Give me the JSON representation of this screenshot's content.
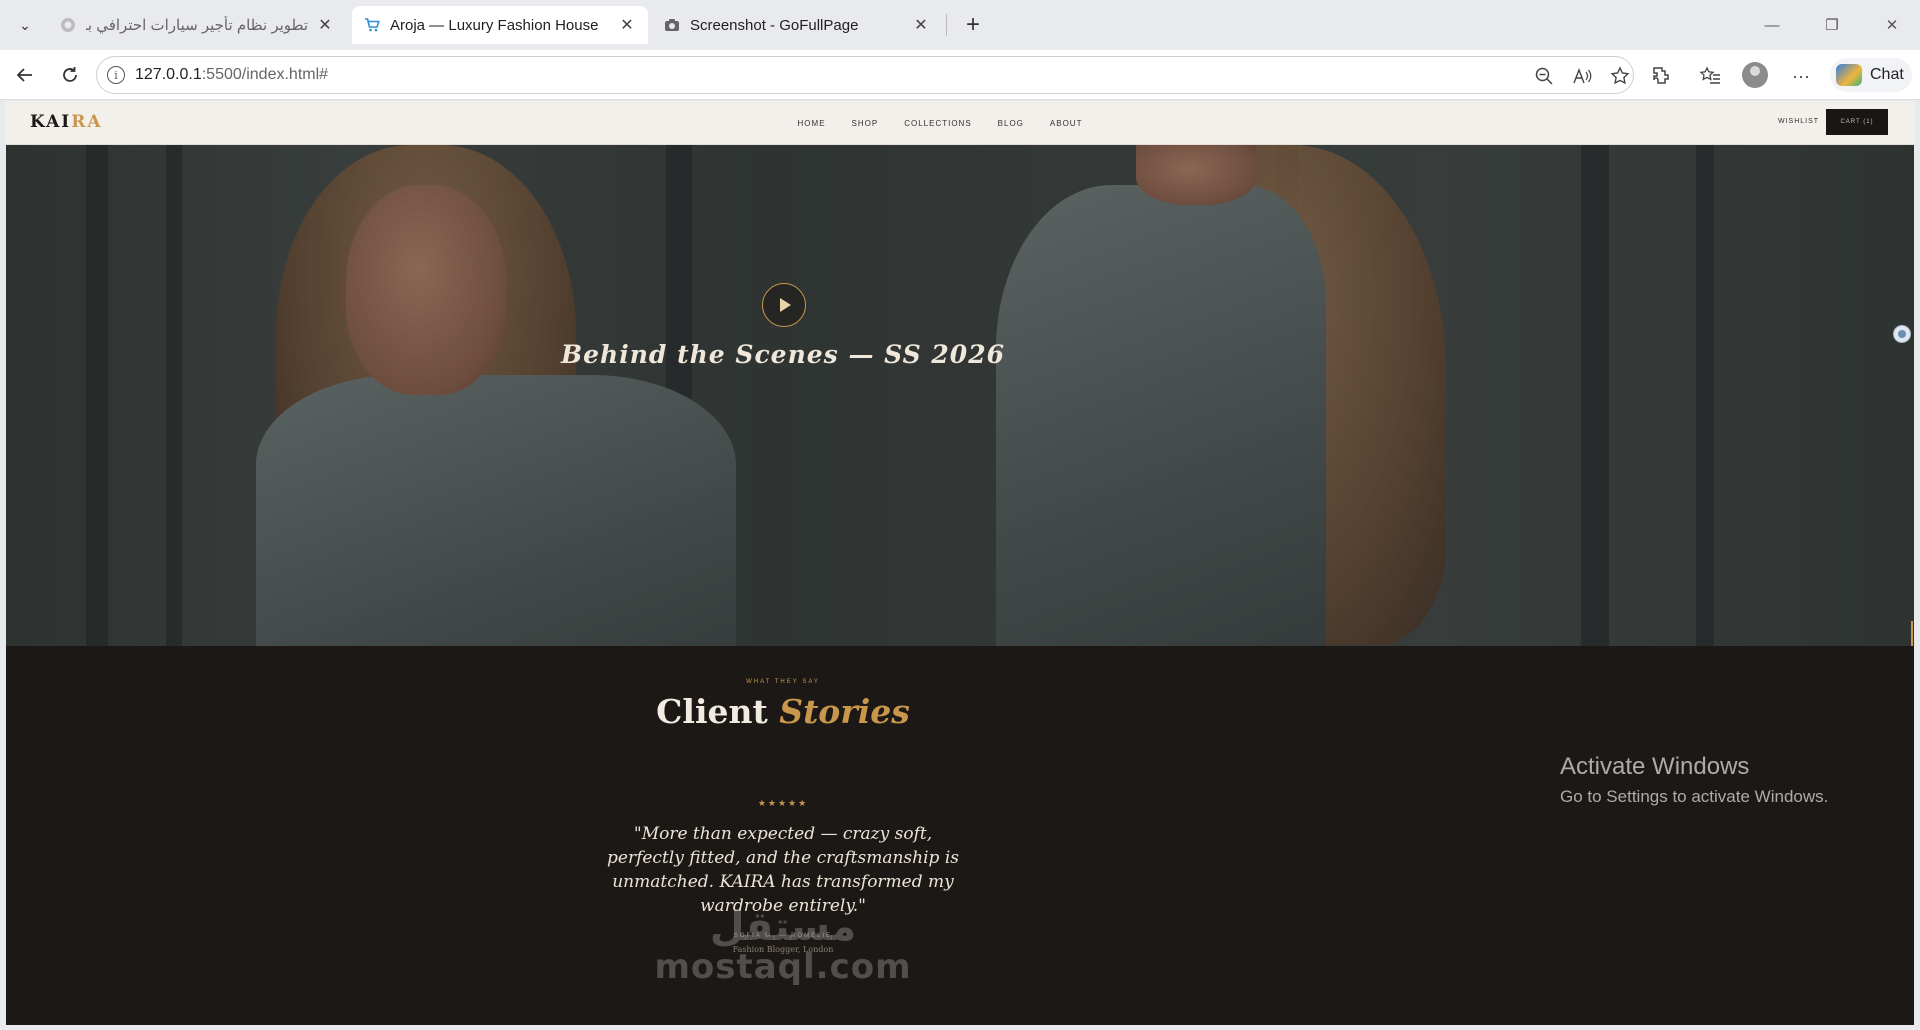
{
  "browser": {
    "tabs": [
      {
        "title": "تطوير نظام تأجير سيارات احترافي با...",
        "favicon": "loading-circle-icon"
      },
      {
        "title": "Aroja — Luxury Fashion House",
        "favicon": "cart-icon"
      },
      {
        "title": "Screenshot - GoFullPage",
        "favicon": "camera-icon"
      }
    ],
    "url_host": "127.0.0.1",
    "url_rest": ":5500/index.html#",
    "chat_label": "Chat"
  },
  "site": {
    "logo_main": "KAI",
    "logo_accent": "RA",
    "nav": [
      "HOME",
      "SHOP",
      "COLLECTIONS",
      "BLOG",
      "ABOUT"
    ],
    "wishlist": "WISHLIST",
    "cart": "CART (1)"
  },
  "hero": {
    "title": "Behind the Scenes — SS 2026"
  },
  "stories": {
    "eyebrow": "WHAT THEY SAY",
    "title_main": "Client ",
    "title_accent": "Stories",
    "stars": "★★★★★",
    "rating": 5,
    "quote": "\"More than expected — crazy soft, perfectly fitted, and the craftsmanship is unmatched. KAIRA has transformed my wardrobe entirely.\"",
    "author": "SOFIA M. — ROMELIE",
    "role": "Fashion Blogger, London"
  },
  "overlays": {
    "watermark_ar": "مستقل",
    "watermark_en": "mostaql.com",
    "activate_title": "Activate Windows",
    "activate_sub": "Go to Settings to activate Windows."
  },
  "colors": {
    "accent": "#c9974c",
    "dark": "#1c1816",
    "header_bg": "#f3efea"
  }
}
